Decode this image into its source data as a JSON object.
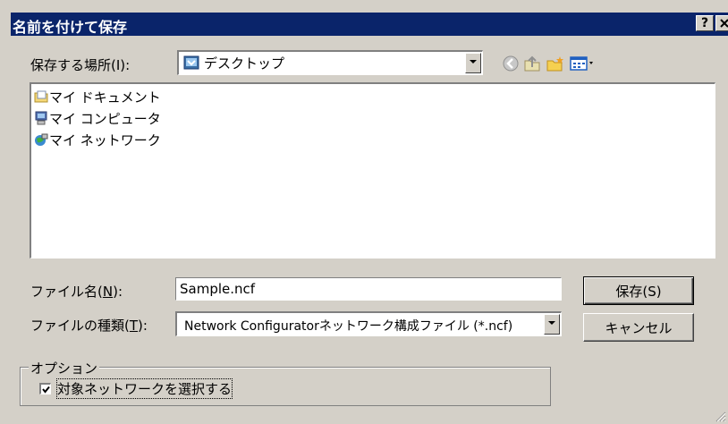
{
  "window": {
    "title": "名前を付けて保存",
    "help_label": "?",
    "close_label": "✕"
  },
  "save_in": {
    "label": "保存する場所(I):",
    "value": "デスクトップ"
  },
  "toolbar": {
    "icons": [
      "back-icon",
      "up-folder-icon",
      "new-folder-icon",
      "view-menu-icon"
    ]
  },
  "file_list": {
    "items": [
      {
        "label": "マイ ドキュメント",
        "icon": "my-documents-icon"
      },
      {
        "label": "マイ コンピュータ",
        "icon": "my-computer-icon"
      },
      {
        "label": "マイ ネットワーク",
        "icon": "my-network-icon"
      }
    ]
  },
  "file_name": {
    "label": "ファイル名(N):",
    "value": "Sample.ncf"
  },
  "file_type": {
    "label": "ファイルの種類(T):",
    "value": "Network Configuratorネットワーク構成ファイル (*.ncf)"
  },
  "buttons": {
    "save": "保存(S)",
    "cancel": "キャンセル"
  },
  "options": {
    "legend": "オプション",
    "checkbox_label": "対象ネットワークを選択する",
    "checked": true
  },
  "colors": {
    "titlebar": "#0a246a",
    "face": "#d4d0c8"
  }
}
